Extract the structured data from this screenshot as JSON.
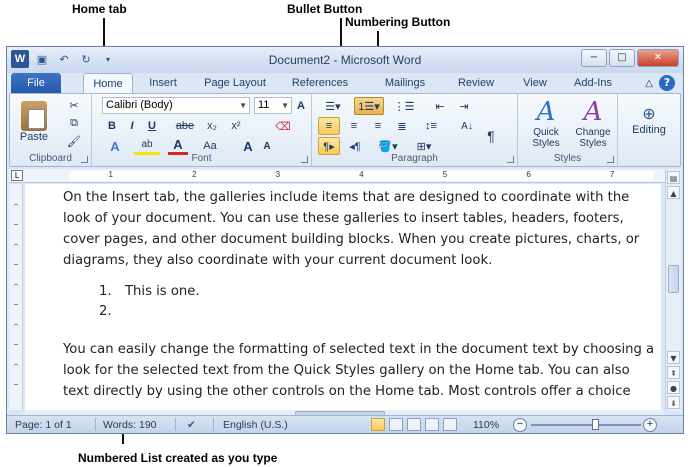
{
  "callouts": {
    "home_tab": "Home tab",
    "bullet_button": "Bullet Button",
    "numbering_button": "Numbering Button",
    "numbered_list": "Numbered List created as you type"
  },
  "titlebar": {
    "app_icon_letter": "W",
    "title": "Document2 - Microsoft Word",
    "minimize": "−",
    "maximize": "□",
    "close": "✕"
  },
  "tabs": {
    "file": "File",
    "home": "Home",
    "insert": "Insert",
    "page_layout": "Page Layout",
    "references": "References",
    "mailings": "Mailings",
    "review": "Review",
    "view": "View",
    "addins": "Add-Ins",
    "help": "?"
  },
  "ribbon": {
    "clipboard": {
      "label": "Clipboard",
      "paste": "Paste"
    },
    "font": {
      "label": "Font",
      "font_name": "Calibri (Body)",
      "font_size": "11",
      "bold": "B",
      "italic": "I",
      "underline": "U",
      "strikethrough": "abe",
      "subscript": "x₂",
      "superscript": "x²",
      "text_effects": "A",
      "highlight": "ab",
      "font_color": "A",
      "change_case": "Aa",
      "grow_font": "A",
      "shrink_font": "A"
    },
    "paragraph": {
      "label": "Paragraph",
      "sort": "A↓",
      "pilcrow": "¶"
    },
    "styles": {
      "label": "Styles",
      "quick_styles": "Quick Styles",
      "change_styles": "Change Styles"
    },
    "editing": {
      "label": "Editing"
    }
  },
  "ruler": {
    "numbers": [
      "1",
      "2",
      "3",
      "4",
      "5",
      "6",
      "7"
    ]
  },
  "document": {
    "para1": [
      "On the Insert tab, the galleries include items that are designed to coordinate with the",
      "look of your document. You can use these galleries to insert tables, headers, footers,",
      "cover pages, and other document building blocks. When you create pictures, charts, or",
      "diagrams, they also coordinate with your current document look."
    ],
    "list": [
      {
        "num": "1.",
        "text": "This is one."
      },
      {
        "num": "2.",
        "text": ""
      }
    ],
    "para2": [
      "You can easily change the formatting of selected text in the document text by choosing a",
      "look for the selected text from the Quick Styles gallery on the Home tab. You can also",
      "text directly by using the other controls on the Home tab. Most controls offer a choice"
    ]
  },
  "statusbar": {
    "page": "Page: 1 of 1",
    "words": "Words: 190",
    "language": "English (U.S.)",
    "zoom": "110%",
    "zoom_out": "−",
    "zoom_in": "+"
  }
}
